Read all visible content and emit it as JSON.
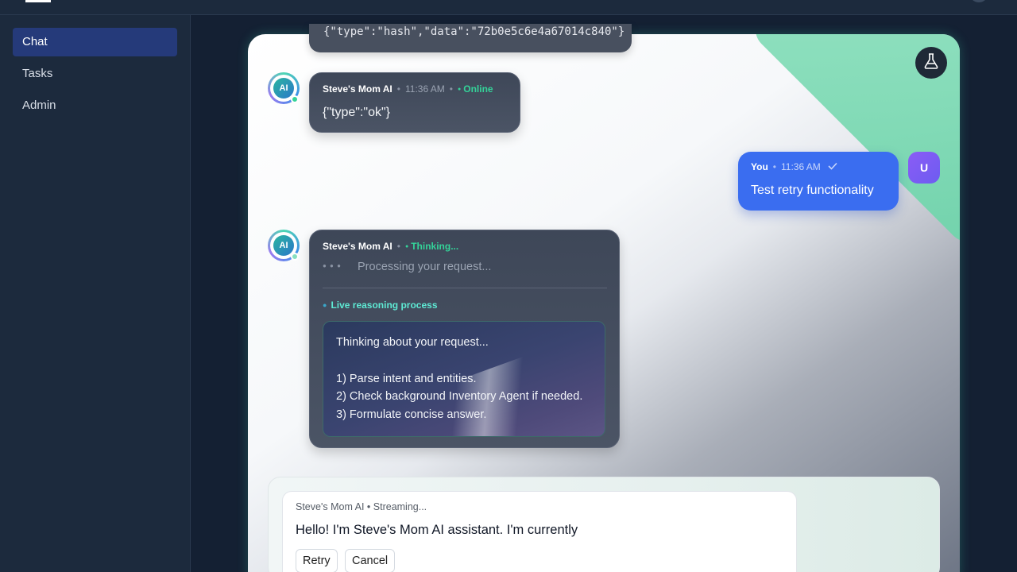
{
  "sidebar": {
    "items": [
      {
        "label": "Chat",
        "active": true
      },
      {
        "label": "Tasks",
        "active": false
      },
      {
        "label": "Admin",
        "active": false
      }
    ]
  },
  "messages": {
    "prev_partial": {
      "text": "{\"type\":\"hash\",\"data\":\"72b0e5c6e4a67014c840\"}"
    },
    "ai_ok": {
      "sender": "Steve's Mom AI",
      "time": "11:36 AM",
      "status": "Online",
      "text": "{\"type\":\"ok\"}",
      "avatar": "AI"
    },
    "user": {
      "sender": "You",
      "time": "11:36 AM",
      "text": "Test retry functionality",
      "avatar": "U"
    },
    "ai_thinking": {
      "sender": "Steve's Mom AI",
      "status": "Thinking...",
      "processing": "Processing your request...",
      "reasoning_label": "Live reasoning process",
      "reasoning": [
        "Thinking about your request...",
        "",
        "1) Parse intent and entities.",
        "2) Check background Inventory Agent if needed.",
        "3) Formulate concise answer."
      ],
      "avatar": "AI"
    }
  },
  "stream": {
    "header": "Steve's Mom AI • Streaming...",
    "text": "Hello! I'm Steve's Mom AI assistant. I'm currently",
    "retry_label": "Retry",
    "cancel_label": "Cancel"
  },
  "colors": {
    "accent": "#3a6df0",
    "online": "#34d399",
    "sidebar_active": "#253a7a"
  },
  "icons": {
    "flask": "flask-icon",
    "check": "check-icon"
  }
}
